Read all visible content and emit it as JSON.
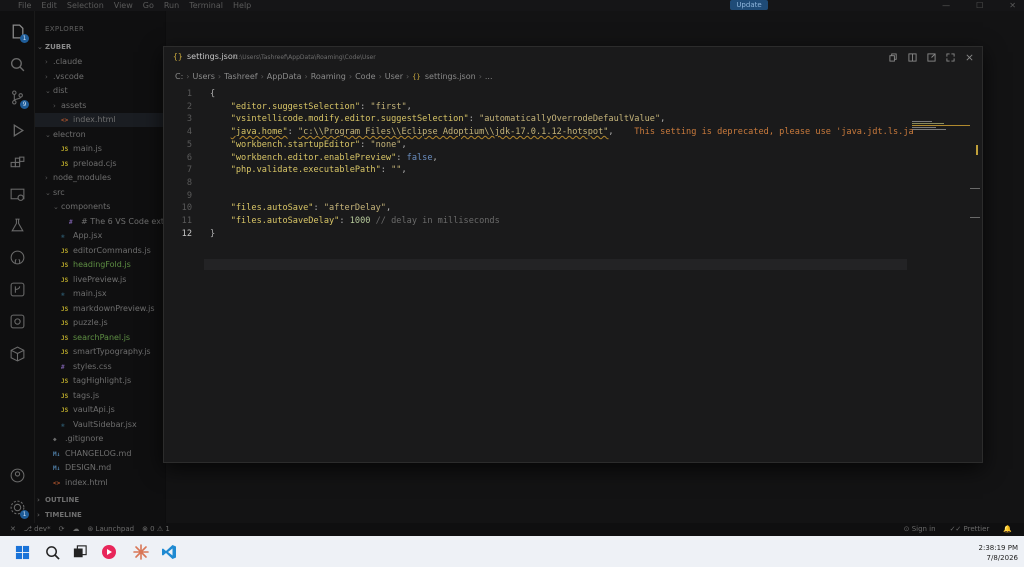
{
  "titlebar": {
    "menu": [
      "File",
      "Edit",
      "Selection",
      "View",
      "Go",
      "Run",
      "Terminal",
      "Help"
    ],
    "update_label": "Update"
  },
  "sidebar": {
    "header": "EXPLORER",
    "root": "ZUBER",
    "items": [
      {
        "label": ".claude",
        "type": "folder",
        "chev": "›",
        "indent": 1
      },
      {
        "label": ".vscode",
        "type": "folder",
        "chev": "›",
        "indent": 1
      },
      {
        "label": "dist",
        "type": "folder",
        "chev": "⌄",
        "indent": 1
      },
      {
        "label": "assets",
        "type": "folder",
        "chev": "›",
        "indent": 2
      },
      {
        "label": "index.html",
        "type": "html",
        "chev": "",
        "indent": 2,
        "selected": true
      },
      {
        "label": "electron",
        "type": "folder",
        "chev": "⌄",
        "indent": 1
      },
      {
        "label": "main.js",
        "type": "js",
        "chev": "",
        "indent": 2
      },
      {
        "label": "preload.cjs",
        "type": "js",
        "chev": "",
        "indent": 2
      },
      {
        "label": "node_modules",
        "type": "folder",
        "chev": "›",
        "indent": 1
      },
      {
        "label": "src",
        "type": "folder",
        "chev": "⌄",
        "indent": 1
      },
      {
        "label": "components",
        "type": "folder",
        "chev": "⌄",
        "indent": 2
      },
      {
        "label": "# The 6 VS Code extensions",
        "type": "hash",
        "chev": "",
        "indent": 3
      },
      {
        "label": "App.jsx",
        "type": "react",
        "chev": "",
        "indent": 2
      },
      {
        "label": "editorCommands.js",
        "type": "js",
        "chev": "",
        "indent": 2
      },
      {
        "label": "headingFold.js",
        "type": "js",
        "chev": "",
        "indent": 2,
        "color": "green"
      },
      {
        "label": "livePreview.js",
        "type": "js",
        "chev": "",
        "indent": 2
      },
      {
        "label": "main.jsx",
        "type": "react",
        "chev": "",
        "indent": 2
      },
      {
        "label": "markdownPreview.js",
        "type": "js",
        "chev": "",
        "indent": 2
      },
      {
        "label": "puzzle.js",
        "type": "js",
        "chev": "",
        "indent": 2
      },
      {
        "label": "searchPanel.js",
        "type": "js",
        "chev": "",
        "indent": 2,
        "color": "green"
      },
      {
        "label": "smartTypography.js",
        "type": "js",
        "chev": "",
        "indent": 2
      },
      {
        "label": "styles.css",
        "type": "hash",
        "chev": "",
        "indent": 2
      },
      {
        "label": "tagHighlight.js",
        "type": "js",
        "chev": "",
        "indent": 2
      },
      {
        "label": "tags.js",
        "type": "js",
        "chev": "",
        "indent": 2
      },
      {
        "label": "vaultApi.js",
        "type": "js",
        "chev": "",
        "indent": 2
      },
      {
        "label": "VaultSidebar.jsx",
        "type": "react",
        "chev": "",
        "indent": 2
      },
      {
        "label": ".gitignore",
        "type": "git",
        "chev": "",
        "indent": 1
      },
      {
        "label": "CHANGELOG.md",
        "type": "md",
        "chev": "",
        "indent": 1
      },
      {
        "label": "DESIGN.md",
        "type": "md",
        "chev": "",
        "indent": 1
      },
      {
        "label": "index.html",
        "type": "html",
        "chev": "",
        "indent": 1
      }
    ],
    "sections": [
      "OUTLINE",
      "TIMELINE"
    ]
  },
  "dialog": {
    "title": "settings.json",
    "path": "C:\\Users\\Tashreef\\AppData\\Roaming\\Code\\User",
    "breadcrumb": [
      "C:",
      "Users",
      "Tashreef",
      "AppData",
      "Roaming",
      "Code",
      "User",
      "settings.json",
      "..."
    ]
  },
  "code": {
    "lines": [
      {
        "n": "1",
        "tokens": [
          {
            "t": "{",
            "c": "p"
          }
        ]
      },
      {
        "n": "2",
        "tokens": [
          {
            "t": "    ",
            "c": "p"
          },
          {
            "t": "\"editor.suggestSelection\"",
            "c": "k"
          },
          {
            "t": ": ",
            "c": "p"
          },
          {
            "t": "\"first\"",
            "c": "s"
          },
          {
            "t": ",",
            "c": "p"
          }
        ]
      },
      {
        "n": "3",
        "tokens": [
          {
            "t": "    ",
            "c": "p"
          },
          {
            "t": "\"vsintellicode.modify.editor.suggestSelection\"",
            "c": "k"
          },
          {
            "t": ": ",
            "c": "p"
          },
          {
            "t": "\"automaticallyOverrodeDefaultValue\"",
            "c": "s"
          },
          {
            "t": ",",
            "c": "p"
          }
        ]
      },
      {
        "n": "4",
        "tokens": [
          {
            "t": "    ",
            "c": "p"
          },
          {
            "t": "\"java.home\"",
            "c": "k squig"
          },
          {
            "t": ": ",
            "c": "p"
          },
          {
            "t": "\"c:\\\\Program Files\\\\Eclipse Adoptium\\\\jdk-17.0.1.12-hotspot\"",
            "c": "s squig"
          },
          {
            "t": ",",
            "c": "p"
          },
          {
            "t": "    This setting is deprecated, please use 'java.jdt.ls.ja",
            "c": "warnline"
          }
        ]
      },
      {
        "n": "5",
        "tokens": [
          {
            "t": "    ",
            "c": "p"
          },
          {
            "t": "\"workbench.startupEditor\"",
            "c": "k"
          },
          {
            "t": ": ",
            "c": "p"
          },
          {
            "t": "\"none\"",
            "c": "s"
          },
          {
            "t": ",",
            "c": "p"
          }
        ]
      },
      {
        "n": "6",
        "tokens": [
          {
            "t": "    ",
            "c": "p"
          },
          {
            "t": "\"workbench.editor.enablePreview\"",
            "c": "k"
          },
          {
            "t": ": ",
            "c": "p"
          },
          {
            "t": "false",
            "c": "kw"
          },
          {
            "t": ",",
            "c": "p"
          }
        ]
      },
      {
        "n": "7",
        "tokens": [
          {
            "t": "    ",
            "c": "p"
          },
          {
            "t": "\"php.validate.executablePath\"",
            "c": "k"
          },
          {
            "t": ": ",
            "c": "p"
          },
          {
            "t": "\"\"",
            "c": "s"
          },
          {
            "t": ",",
            "c": "p"
          }
        ]
      },
      {
        "n": "8",
        "tokens": []
      },
      {
        "n": "9",
        "tokens": []
      },
      {
        "n": "10",
        "tokens": [
          {
            "t": "    ",
            "c": "p"
          },
          {
            "t": "\"files.autoSave\"",
            "c": "k"
          },
          {
            "t": ": ",
            "c": "p"
          },
          {
            "t": "\"afterDelay\"",
            "c": "s"
          },
          {
            "t": ",",
            "c": "p"
          }
        ]
      },
      {
        "n": "11",
        "tokens": [
          {
            "t": "    ",
            "c": "p"
          },
          {
            "t": "\"files.autoSaveDelay\"",
            "c": "k"
          },
          {
            "t": ": ",
            "c": "p"
          },
          {
            "t": "1000",
            "c": "n"
          },
          {
            "t": " // delay in milliseconds",
            "c": "cm"
          }
        ]
      },
      {
        "n": "12",
        "tokens": [
          {
            "t": "}",
            "c": "p"
          }
        ],
        "current": true
      }
    ]
  },
  "statusbar": {
    "branch": "dev*",
    "launchpad": "Launchpad",
    "errors": "0",
    "warnings": "1",
    "signin": "Sign in",
    "prettier": "Prettier"
  },
  "taskbar": {
    "time": "2:38:19 PM",
    "date": "7/8/2026"
  },
  "colors": {
    "accent": "#1f5d99",
    "warning": "#c97a3c",
    "json_key": "#d8c566"
  }
}
